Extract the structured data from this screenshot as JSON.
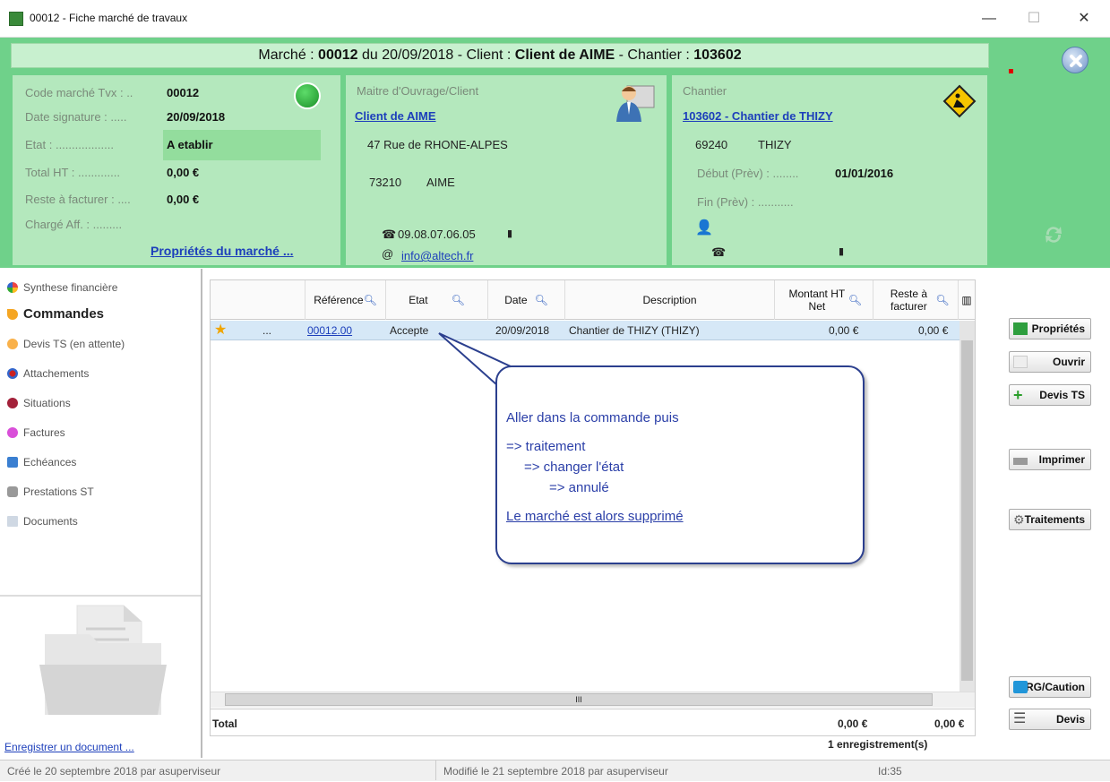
{
  "window": {
    "title": "00012 - Fiche marché de travaux",
    "minimize": "—",
    "maximize": "☐",
    "close": "✕"
  },
  "header": {
    "pre1": "Marché : ",
    "marche_num": "00012",
    "pre2": " du 20/09/2018 - Client : ",
    "client": "Client de AIME",
    "pre3": " - Chantier : ",
    "chantier": "103602"
  },
  "marche": {
    "code_label": "Code marché Tvx : ..",
    "code_value": "00012",
    "date_label": "Date signature : .....",
    "date_value": "20/09/2018",
    "etat_label": "Etat : ..................",
    "etat_value": "A etablir",
    "total_label": "Total HT : .............",
    "total_value": "0,00 €",
    "reste_label": "Reste à facturer : ....",
    "reste_value": "0,00 €",
    "charge_label": "Chargé Aff. : .........",
    "props_link": "Propriétés du marché ..."
  },
  "maitre": {
    "title": "Maitre d'Ouvrage/Client",
    "name": "Client de AIME",
    "address": "47 Rue de RHONE-ALPES",
    "cp": "73210",
    "ville": "AIME",
    "phone": "09.08.07.06.05",
    "email": "info@altech.fr"
  },
  "chantier": {
    "title": "Chantier",
    "name": "103602 - Chantier de THIZY",
    "cp": "69240",
    "ville": "THIZY",
    "debut_label": "Début (Prèv) : ........",
    "debut_value": "01/01/2016",
    "fin_label": "Fin (Prèv) : ..........."
  },
  "nav": {
    "items": [
      "Synthese financière",
      "Commandes",
      "Devis TS (en attente)",
      "Attachements",
      "Situations",
      "Factures",
      "Echéances",
      "Prestations ST",
      "Documents"
    ],
    "register_link": "Enregistrer un document ..."
  },
  "grid": {
    "headers": {
      "ref": "Référence",
      "etat": "Etat",
      "date": "Date",
      "desc": "Description",
      "montant": "Montant HT Net",
      "reste": "Reste à facturer"
    },
    "row": {
      "dots": "...",
      "ref": "00012.00",
      "etat": "Accepte",
      "date": "20/09/2018",
      "desc": "Chantier de THIZY (THIZY)",
      "montant": "0,00 €",
      "reste": "0,00 €"
    },
    "total_label": "Total",
    "total_montant": "0,00 €",
    "total_reste": "0,00 €",
    "count": "1 enregistrement(s)"
  },
  "callout": {
    "line1": "Aller dans la commande puis",
    "line2": "=> traitement",
    "line3": "=> changer l'état",
    "line4": "=> annulé",
    "line5": "Le marché est alors supprimé"
  },
  "buttons": {
    "props": "Propriétés",
    "ouvrir": "Ouvrir",
    "devis_ts": "Devis TS",
    "imprimer": "Imprimer",
    "traitements": "Traitements",
    "rg": "RG/Caution",
    "devis": "Devis"
  },
  "status": {
    "created": "Créé le 20 septembre 2018 par asuperviseur",
    "modified": "Modifié le 21 septembre 2018 par asuperviseur",
    "id": "Id:35"
  }
}
